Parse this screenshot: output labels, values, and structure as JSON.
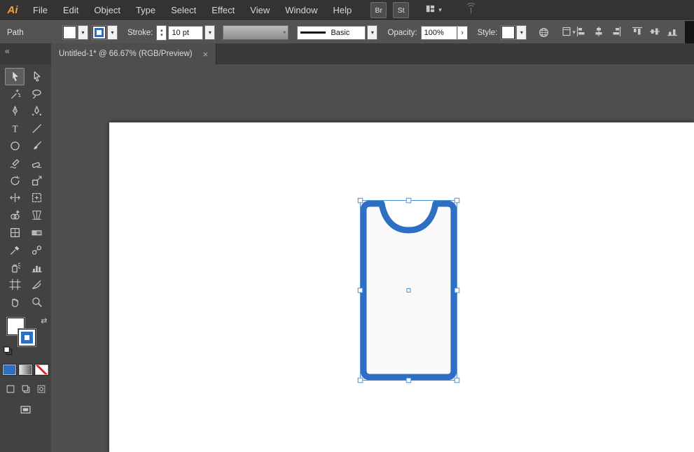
{
  "app": {
    "logo_text": "Ai"
  },
  "menubar": {
    "menus": [
      "File",
      "Edit",
      "Object",
      "Type",
      "Select",
      "Effect",
      "View",
      "Window",
      "Help"
    ],
    "bridge_button": "Br",
    "stock_button": "St"
  },
  "controlbar": {
    "context_label": "Path",
    "stroke_label": "Stroke:",
    "stroke_width_value": "10 pt",
    "brush_definition": "Basic",
    "opacity_label": "Opacity:",
    "opacity_value": "100%",
    "style_label": "Style:"
  },
  "tabbar": {
    "collapse_glyph": "«",
    "tab_title": "Untitled-1* @ 66.67% (RGB/Preview)",
    "close_glyph": "×"
  },
  "toolbar": {
    "selected_tool": "selection",
    "tools": [
      "selection",
      "direct-selection",
      "magic-wand",
      "lasso",
      "pen",
      "curvature",
      "type",
      "line-segment",
      "ellipse",
      "paintbrush",
      "shaper",
      "eraser",
      "rotate",
      "scale",
      "width",
      "free-transform",
      "shape-builder",
      "perspective-grid",
      "mesh",
      "gradient",
      "eyedropper",
      "blend",
      "symbol-sprayer",
      "column-graph",
      "artboard",
      "slice",
      "hand",
      "zoom"
    ]
  },
  "swatches": {
    "fill_color": "#ffffff",
    "stroke_color": "#2e6fc4"
  },
  "canvas": {
    "zoom_level": "66.67%",
    "shape": {
      "type": "rounded-rectangle-with-top-notch",
      "fill": "#fafafa",
      "stroke": "#2e6fc4",
      "stroke_width_px": 9,
      "selection_color": "#4a90d9"
    }
  }
}
